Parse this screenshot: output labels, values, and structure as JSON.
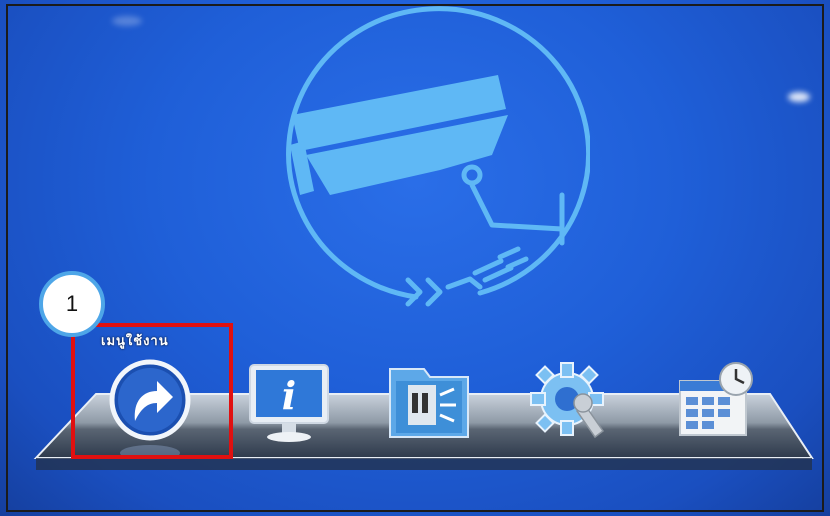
{
  "menu": {
    "main_menu_label": "เมนูใช้งาน",
    "items": [
      {
        "name": "main-menu",
        "icon": "return-arrow-icon"
      },
      {
        "name": "system-info",
        "icon": "monitor-info-icon"
      },
      {
        "name": "playback",
        "icon": "film-folder-icon"
      },
      {
        "name": "settings",
        "icon": "gear-wrench-icon"
      },
      {
        "name": "schedule",
        "icon": "calendar-clock-icon"
      }
    ]
  },
  "annotation": {
    "step_number": "1",
    "highlight_color": "#e01010",
    "badge_border_color": "#4ea6e8"
  },
  "colors": {
    "background": "#1f5fd8",
    "logo": "#5fb8f5"
  }
}
